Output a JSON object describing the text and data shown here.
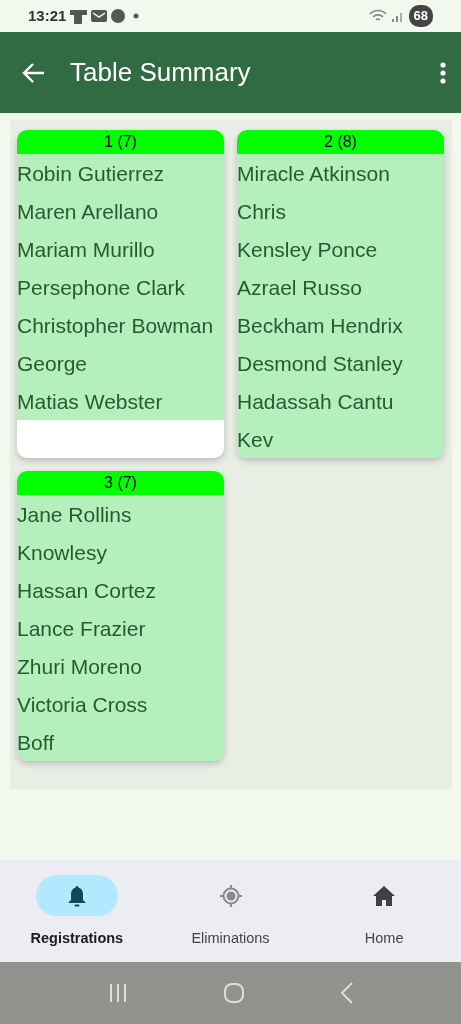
{
  "status_bar": {
    "time": "13:21",
    "battery": "68"
  },
  "app_bar": {
    "title": "Table Summary"
  },
  "tables": [
    {
      "title": "1 (7)",
      "players": [
        "Robin Gutierrez",
        "Maren Arellano",
        "Mariam Murillo",
        "Persephone Clark",
        "Christopher Bowman",
        "George",
        "Matias Webster"
      ]
    },
    {
      "title": "2 (8)",
      "players": [
        "Miracle Atkinson",
        "Chris",
        "Kensley Ponce",
        "Azrael Russo",
        "Beckham Hendrix",
        "Desmond Stanley",
        "Hadassah Cantu",
        "Kev"
      ]
    },
    {
      "title": "3 (7)",
      "players": [
        "Jane Rollins",
        "Knowlesy",
        "Hassan Cortez",
        "Lance Frazier",
        "Zhuri Moreno",
        "Victoria Cross",
        "Boff"
      ]
    }
  ],
  "bottom_nav": [
    {
      "label": "Registrations",
      "kind": "bell",
      "selected": true
    },
    {
      "label": "Eliminations",
      "kind": "target",
      "selected": false
    },
    {
      "label": "Home",
      "kind": "home",
      "selected": false
    }
  ]
}
